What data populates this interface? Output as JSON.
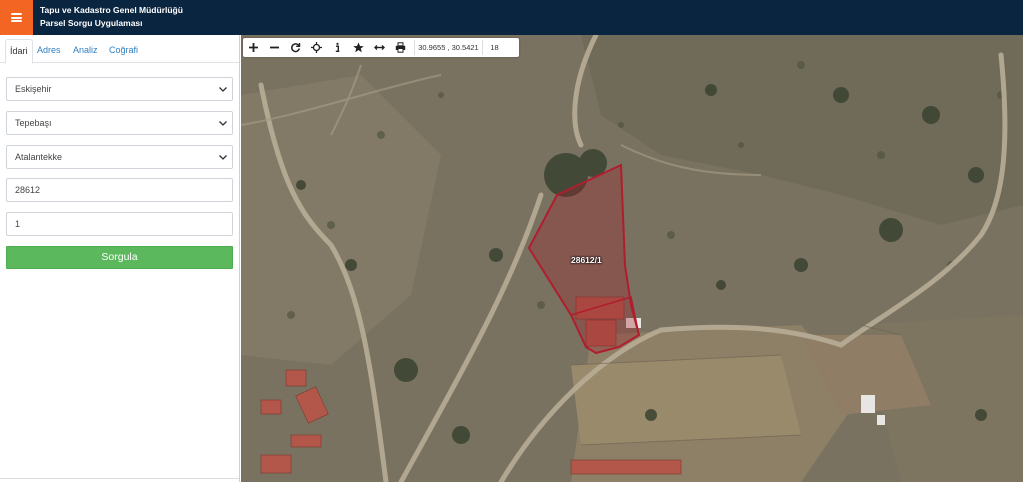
{
  "header": {
    "line1": "Tapu ve Kadastro Genel Müdürlüğü",
    "line2": "Parsel Sorgu Uygulaması",
    "menu_icon": "hamburger-icon",
    "colors": {
      "background": "#0a2540",
      "menu_button": "#f26522"
    }
  },
  "sidebar": {
    "tabs": [
      {
        "label": "İdari",
        "active": true
      },
      {
        "label": "Adres",
        "active": false
      },
      {
        "label": "Analiz",
        "active": false
      },
      {
        "label": "Coğrafi",
        "active": false
      }
    ],
    "il": "Eskişehir",
    "ilce": "Tepebaşı",
    "mahalle": "Atalantekke",
    "ada": "28612",
    "parsel": "1",
    "submit_label": "Sorgula",
    "submit_color": "#5cb85c"
  },
  "map": {
    "toolbar": {
      "icons": [
        "plus-icon",
        "minus-icon",
        "refresh-icon",
        "locate-icon",
        "info-icon",
        "star-icon",
        "measure-icon",
        "print-icon"
      ],
      "coordinates": "30.9655 , 30.5421",
      "zoom": "18"
    },
    "parcel_label": "28612/1",
    "parcel_color": "#b01e2e"
  }
}
